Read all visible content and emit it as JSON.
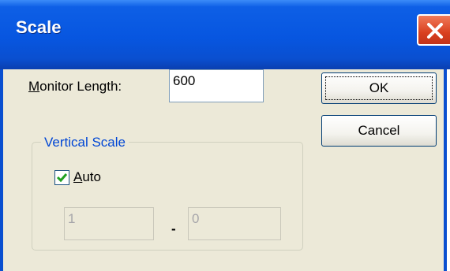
{
  "window": {
    "title": "Scale"
  },
  "monitor": {
    "label_first": "M",
    "label_rest": "onitor Length:",
    "value": "600"
  },
  "buttons": {
    "ok": "OK",
    "cancel": "Cancel"
  },
  "vertical_scale": {
    "title": "Vertical Scale",
    "auto": {
      "first": "A",
      "rest": "uto",
      "checked": true
    },
    "min_value": "1",
    "separator": "-",
    "max_value": "0"
  },
  "colors": {
    "titlebar": "#0756e0",
    "dialog_bg": "#ece9d8",
    "group_title": "#0046d5",
    "close": "#d9401f"
  },
  "icons": {
    "close": "close-icon",
    "check": "checkmark-icon"
  }
}
